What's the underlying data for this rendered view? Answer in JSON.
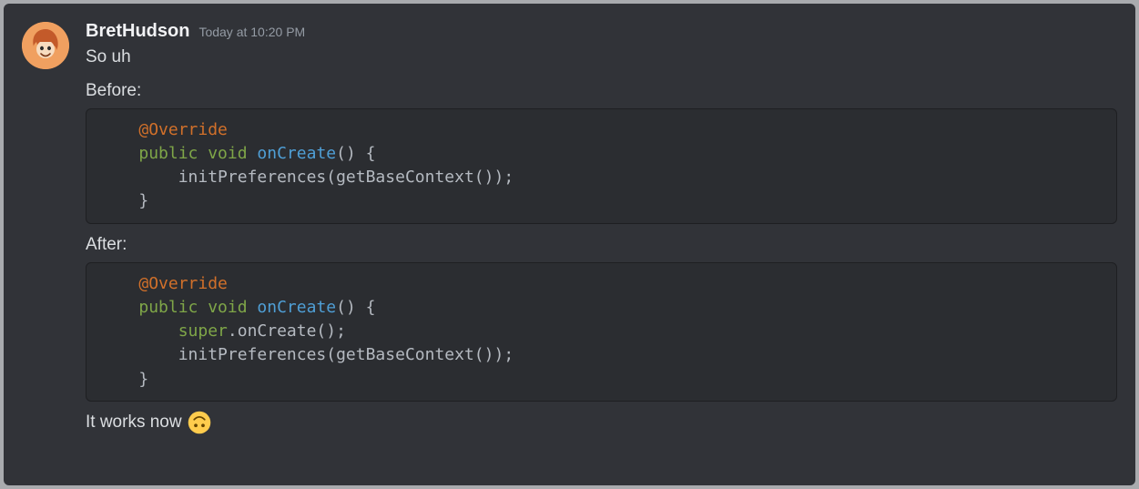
{
  "message": {
    "username": "BretHudson",
    "timestamp": "Today at 10:20 PM",
    "line1": "So uh",
    "before_label": "Before:",
    "after_label": "After:",
    "footer_text": "It works now ",
    "emoji_name": "upside_down_face"
  },
  "code_before": {
    "indent": "    ",
    "l1": "@Override",
    "l2_kw": "public void",
    "l2_fn": "onCreate",
    "l2_rest": "() {",
    "l3": "        initPreferences(getBaseContext());",
    "l4": "    }"
  },
  "code_after": {
    "indent": "    ",
    "l1": "@Override",
    "l2_kw": "public void",
    "l2_fn": "onCreate",
    "l2_rest": "() {",
    "l3a_pre": "        ",
    "l3a_super": "super",
    "l3a_rest": ".onCreate();",
    "l3b": "        initPreferences(getBaseContext());",
    "l4": "    }"
  },
  "colors": {
    "bg": "#313338",
    "code_bg": "#2b2d31",
    "text": "#dbdee1",
    "muted": "#949ba4",
    "annot": "#d1702a",
    "keyword": "#7fa648",
    "func": "#4f9fd6"
  }
}
